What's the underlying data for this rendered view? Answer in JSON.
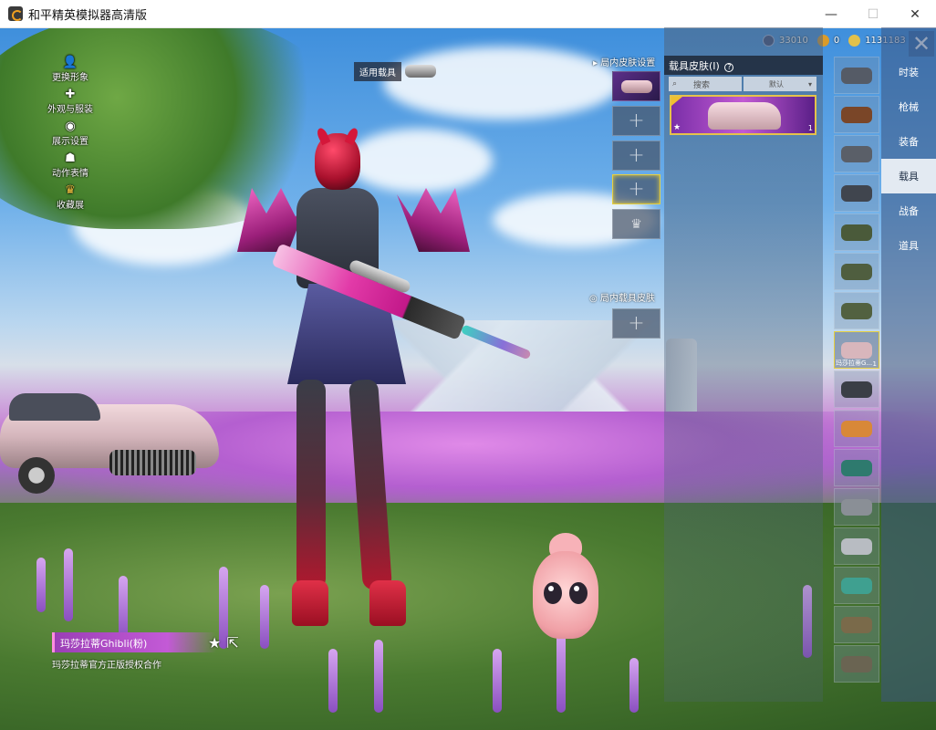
{
  "window": {
    "title": "和平精英模拟器高清版",
    "minimize": "—",
    "maximize": "☐",
    "close": "✕"
  },
  "hud": {
    "menu_items": [
      {
        "label": "更换形象",
        "icon": "person-icon"
      },
      {
        "label": "外观与服装",
        "icon": "puzzle-icon"
      },
      {
        "label": "展示设置",
        "icon": "eye-icon"
      },
      {
        "label": "动作表情",
        "icon": "gesture-icon"
      },
      {
        "label": "收藏展",
        "icon": "crown-icon"
      }
    ]
  },
  "currency": {
    "items": [
      {
        "value": "33010",
        "color": "#3a4c7a"
      },
      {
        "value": "0",
        "color": "#d99b2a"
      },
      {
        "value": "1131183",
        "color": "#e2c14a"
      }
    ],
    "close": "✕"
  },
  "vehicle_tag": {
    "label": "适用载具"
  },
  "skin_set": {
    "title": "局内皮肤设置",
    "slot_add": "+",
    "crown": "♛",
    "secondary_title": "局内载具皮肤"
  },
  "vehicle_skin_panel": {
    "title": "载具皮肤(I)",
    "help": "?",
    "search_label": "搜索",
    "sort_label": "默认",
    "sort_arrow": "▾",
    "card": {
      "star": "★",
      "count": "1"
    }
  },
  "vehicle_list": {
    "items": [
      {
        "name": "motorcycle",
        "color": "#555b66"
      },
      {
        "name": "horse",
        "color": "#7a4628"
      },
      {
        "name": "buggy",
        "color": "#5a5f68"
      },
      {
        "name": "motorbike",
        "color": "#40454e"
      },
      {
        "name": "jeep",
        "color": "#4a5a3a"
      },
      {
        "name": "jeep-2",
        "color": "#4f5e3f"
      },
      {
        "name": "jeep-3",
        "color": "#526140"
      },
      {
        "name": "maserati",
        "color": "#d8b6bc",
        "caption": "玛莎拉蒂G...",
        "count": "1",
        "selected": true
      },
      {
        "name": "monster-truck",
        "color": "#3a3e46"
      },
      {
        "name": "sports-car-orange",
        "color": "#d88838"
      },
      {
        "name": "sports-car-teal",
        "color": "#2e7a6e"
      },
      {
        "name": "sedan",
        "color": "#8a8f96"
      },
      {
        "name": "coupe",
        "color": "#b8bcc2"
      },
      {
        "name": "van",
        "color": "#3fa090"
      },
      {
        "name": "pickup",
        "color": "#7a6a4a"
      },
      {
        "name": "uaz",
        "color": "#6a6452"
      }
    ]
  },
  "categories": {
    "tabs": [
      {
        "label": "时装",
        "active": false
      },
      {
        "label": "枪械",
        "active": false
      },
      {
        "label": "装备",
        "active": false
      },
      {
        "label": "载具",
        "active": true
      },
      {
        "label": "战备",
        "active": false
      },
      {
        "label": "道具",
        "active": false
      }
    ]
  },
  "item": {
    "name": "玛莎拉蒂Ghibli(粉)",
    "star_icon": "★",
    "share_icon": "⇱",
    "description": "玛莎拉蒂官方正版授权合作"
  }
}
